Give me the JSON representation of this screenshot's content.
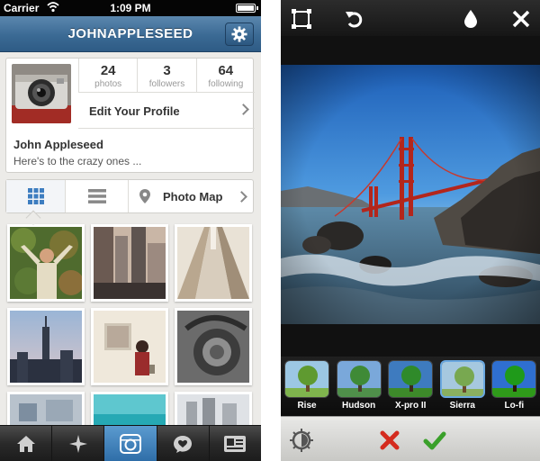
{
  "status_bar": {
    "carrier": "Carrier",
    "time": "1:09 PM"
  },
  "profile_screen": {
    "username": "JOHNAPPLESEED",
    "stats": [
      {
        "value": "24",
        "label": "photos"
      },
      {
        "value": "3",
        "label": "followers"
      },
      {
        "value": "64",
        "label": "following"
      }
    ],
    "edit_profile_label": "Edit Your Profile",
    "display_name": "John Appleseed",
    "bio": "Here's to the crazy ones ...",
    "view_toggle": {
      "grid_icon": "grid-icon",
      "list_icon": "list-icon",
      "map_label": "Photo Map"
    },
    "tabs": [
      {
        "icon": "home-icon"
      },
      {
        "icon": "explore-icon"
      },
      {
        "icon": "camera-icon"
      },
      {
        "icon": "news-icon"
      },
      {
        "icon": "profile-icon"
      }
    ],
    "accent_color": "#3b6a94",
    "active_tab_color": "#3f82bd"
  },
  "filter_screen": {
    "top_icons": [
      "frame-icon",
      "rotate-icon",
      "tilt-shift-icon",
      "close-icon"
    ],
    "filters": [
      {
        "label": "Rise"
      },
      {
        "label": "Hudson"
      },
      {
        "label": "X-pro II"
      },
      {
        "label": "Sierra"
      },
      {
        "label": "Lo-fi"
      }
    ],
    "bottom_icons": [
      "lux-icon",
      "cancel-icon",
      "accept-icon"
    ],
    "cancel_color": "#d42b1e",
    "accept_color": "#3aa02a"
  }
}
